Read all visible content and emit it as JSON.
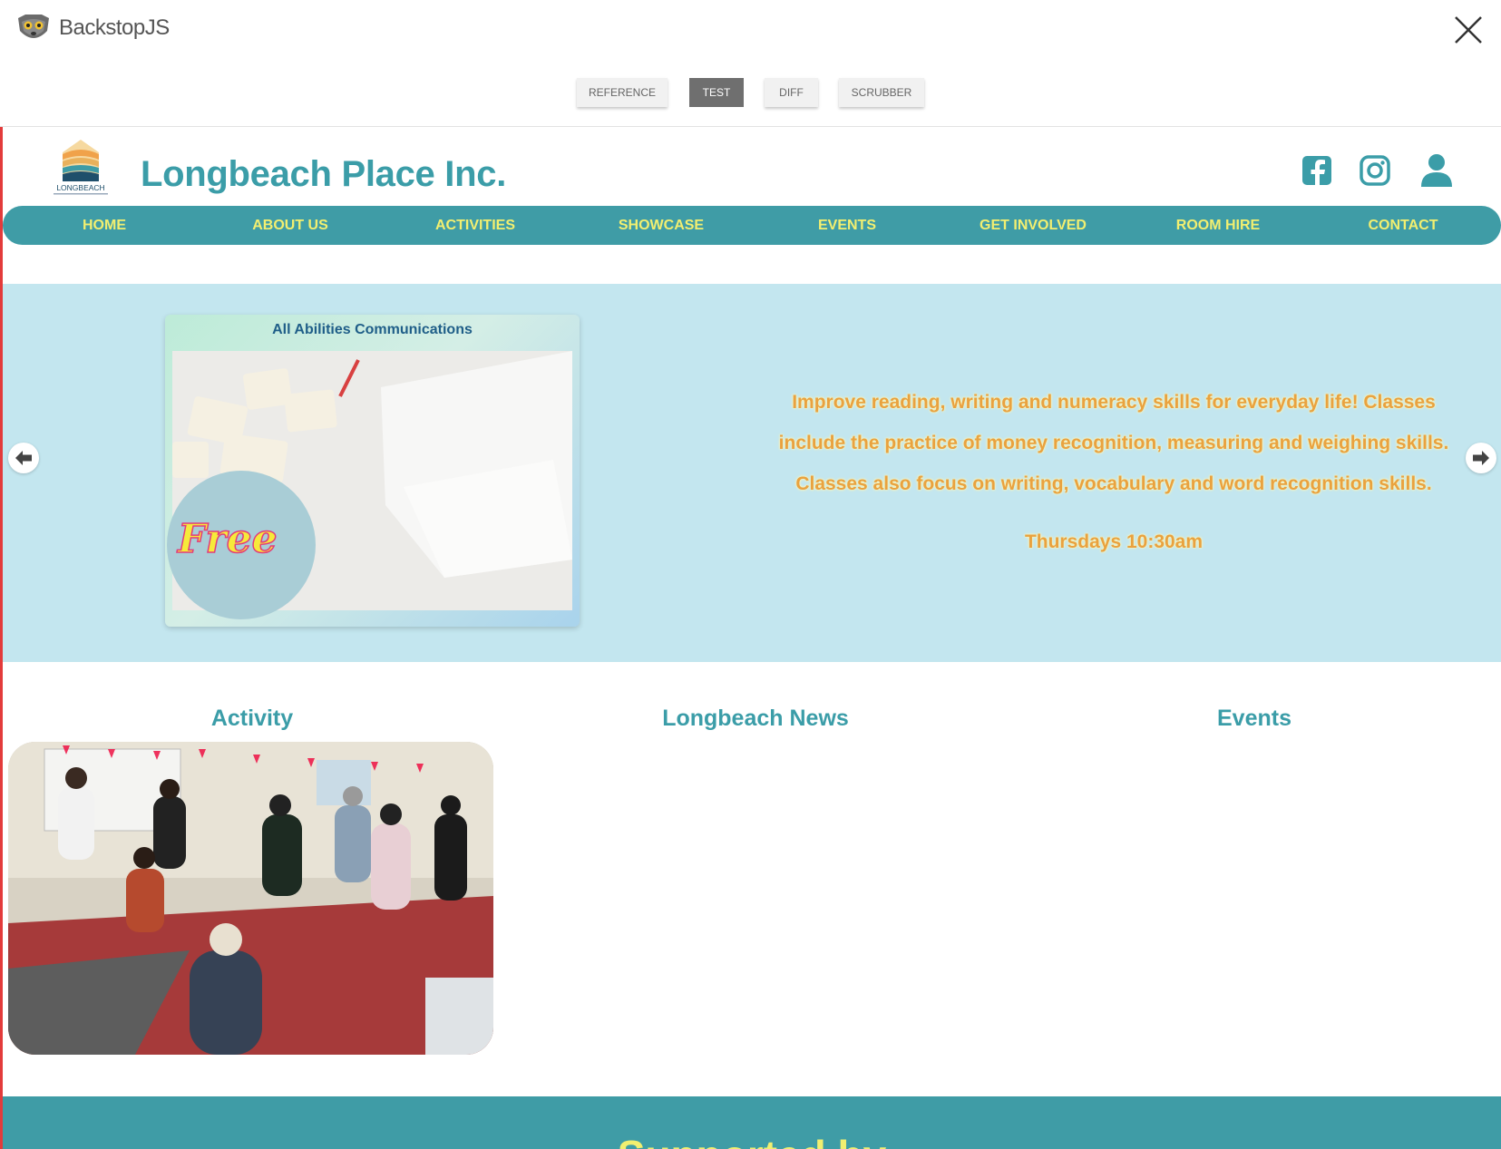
{
  "backstop": {
    "title": "BackstopJS",
    "tabs": [
      "REFERENCE",
      "TEST",
      "DIFF",
      "SCRUBBER"
    ],
    "active_tab": "TEST"
  },
  "site": {
    "logo_text": "LONGBEACH",
    "title": "Longbeach Place Inc.",
    "social_icons": [
      "facebook-icon",
      "instagram-icon",
      "user-icon"
    ],
    "nav": [
      "HOME",
      "ABOUT US",
      "ACTIVITIES",
      "SHOWCASE",
      "EVENTS",
      "GET INVOLVED",
      "ROOM HIRE",
      "CONTACT"
    ]
  },
  "hero": {
    "card_title": "All Abilities Communications",
    "badge": "Free",
    "description": "Improve reading, writing and numeracy skills for everyday life! Classes include the practice of money recognition, measuring and weighing skills. Classes also focus on writing, vocabulary and word recognition skills.",
    "time": "Thursdays 10:30am"
  },
  "sections": {
    "activity": "Activity",
    "news": "Longbeach News",
    "events": "Events"
  },
  "footer": {
    "heading": "Supported by"
  },
  "colors": {
    "teal": "#3f9ca6",
    "nav_text": "#f2ef70",
    "hero_bg": "#c3e6ef",
    "hero_text": "#e9a23f",
    "frame_border": "#e33b3b"
  }
}
